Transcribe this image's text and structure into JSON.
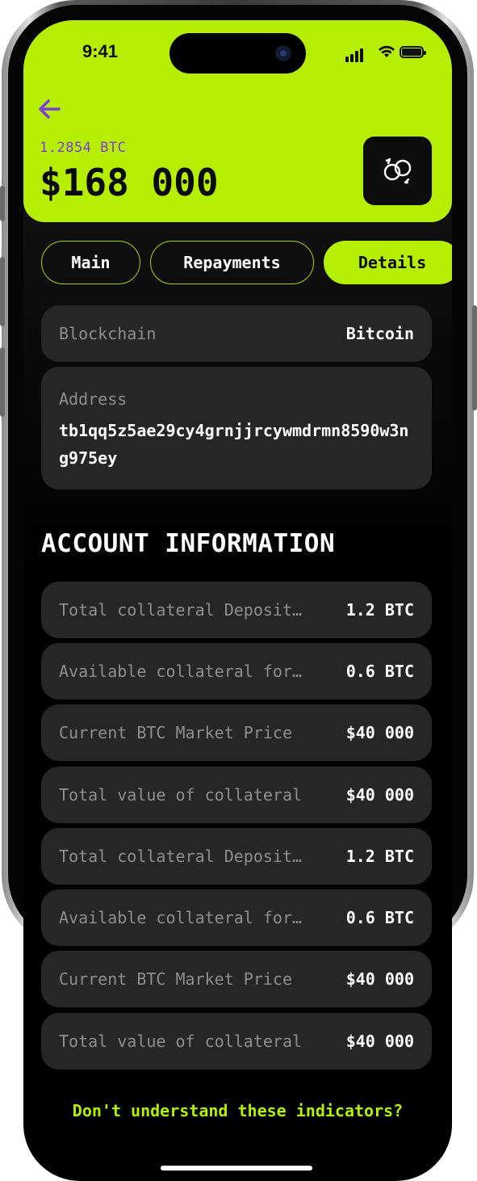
{
  "status_bar": {
    "time": "9:41"
  },
  "header": {
    "btc_amount": "1.2854 BTC",
    "usd_amount": "$168 000",
    "accent_color": "#b6ee00",
    "back_icon": "arrow-left-icon",
    "swap_icon": "coins-swap-icon"
  },
  "tabs": [
    {
      "label": "Main",
      "active": false
    },
    {
      "label": "Repayments",
      "active": false
    },
    {
      "label": "Details",
      "active": true
    }
  ],
  "details": {
    "blockchain_label": "Blockchain",
    "blockchain_value": "Bitcoin",
    "address_label": "Address",
    "address_value": "tb1qq5z5ae29cy4grnjjrcywmdrmn8590w3ng975ey"
  },
  "account_info": {
    "title": "ACCOUNT INFORMATION",
    "rows": [
      {
        "label": "Total collateral Deposited",
        "value": "1.2 BTC"
      },
      {
        "label": "Available collateral for withdrawal",
        "value": "0.6 BTC"
      },
      {
        "label": "Current BTC Market Price",
        "value": "$40 000"
      },
      {
        "label": "Total value of collateral",
        "value": "$40 000"
      },
      {
        "label": "Total collateral Deposited",
        "value": "1.2 BTC"
      },
      {
        "label": "Available collateral for withdrawal",
        "value": "0.6 BTC"
      },
      {
        "label": "Current BTC Market Price",
        "value": "$40 000"
      },
      {
        "label": "Total value of collateral",
        "value": "$40 000"
      }
    ]
  },
  "help_link": "Don't understand these indicators?"
}
